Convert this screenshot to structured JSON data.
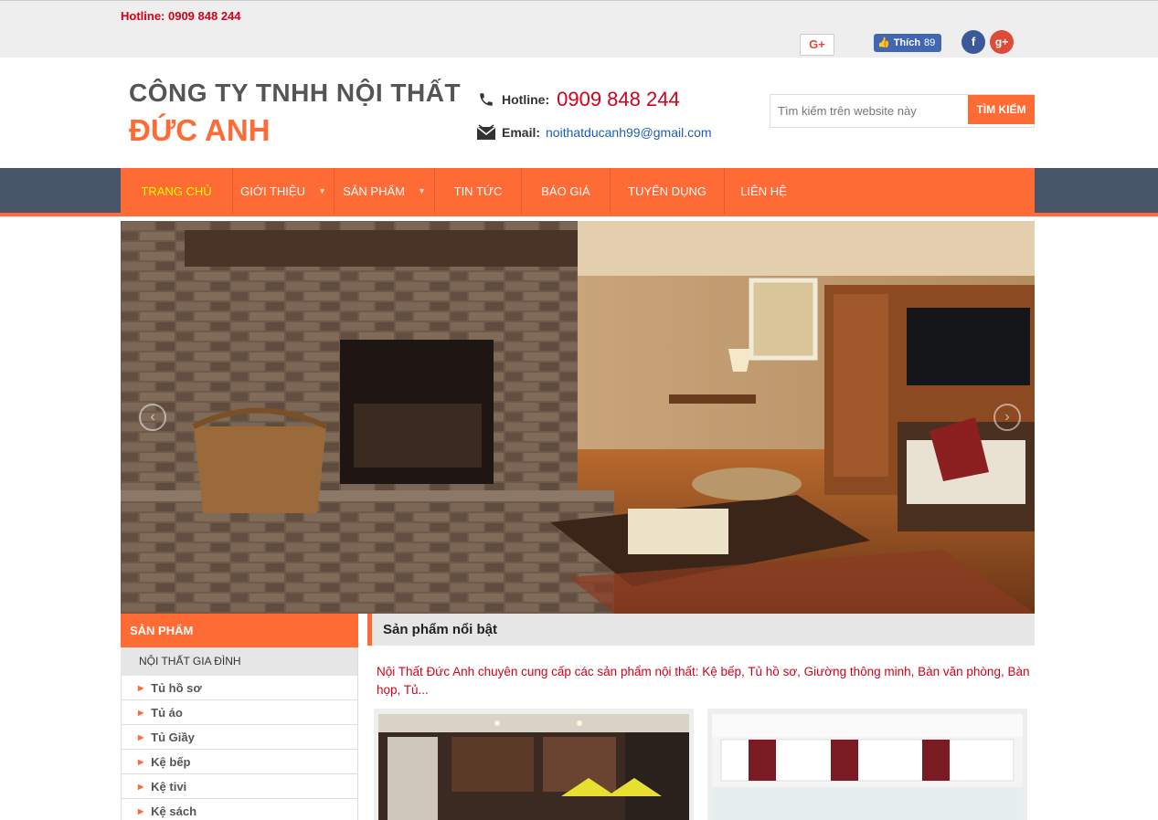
{
  "topbar": {
    "hotline": "Hotline: 0909 848 244",
    "gplus_label": "G+",
    "fb_like_label": "Thích",
    "fb_like_count": "89",
    "social_facebook": "f",
    "social_gplus": "g+"
  },
  "header": {
    "logo_line1": "CÔNG TY TNHH NỘI THẤT",
    "logo_line2": "ĐỨC ANH",
    "hotline_label": "Hotline:",
    "hotline_number": "0909 848 244",
    "email_label": "Email:",
    "email": "noithatducanh99@gmail.com",
    "search_placeholder": "Tìm kiếm trên website này",
    "search_button": "TÌM KIẾM"
  },
  "nav": {
    "items": [
      {
        "label": "TRANG CHỦ",
        "active": true
      },
      {
        "label": "GIỚI THIỆU",
        "dropdown": true
      },
      {
        "label": "SẢN PHẨM",
        "dropdown": true
      },
      {
        "label": "TIN TỨC"
      },
      {
        "label": "BÁO GIÁ"
      },
      {
        "label": "TUYỂN DỤNG"
      },
      {
        "label": "LIÊN HỆ"
      }
    ]
  },
  "slider": {
    "prev": "‹",
    "next": "›"
  },
  "sidebar": {
    "title": "SẢN PHẨM",
    "category": "NỘI THẤT GIA ĐÌNH",
    "items": [
      "Tủ hồ sơ",
      "Tủ áo",
      "Tủ Giầy",
      "Kệ bếp",
      "Kệ tivi",
      "Kệ sách"
    ]
  },
  "main": {
    "heading": "Sản phẩm nổi bật",
    "intro": "Nội Thất Đức Anh chuyên cung cấp các sản phẩm nội thất: Kệ bếp, Tủ hồ sơ, Giường thông minh, Bàn văn phòng, Bàn họp, Tủ..."
  },
  "colors": {
    "accent": "#ff6b35",
    "nav_bg": "#475668",
    "hotline_red": "#d0021b",
    "link_blue": "#1a5fb4"
  }
}
